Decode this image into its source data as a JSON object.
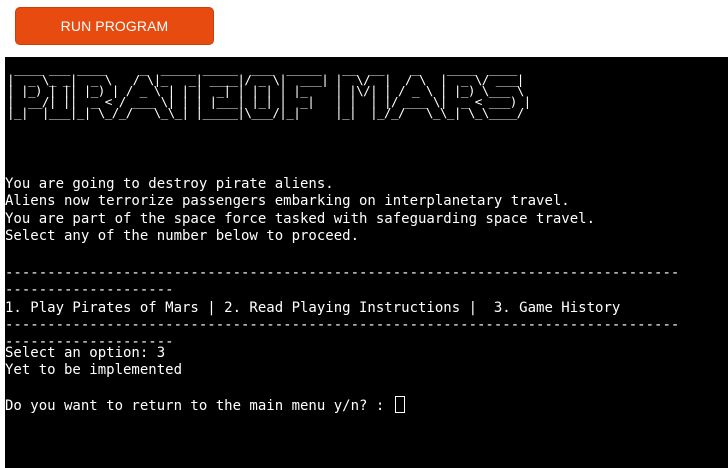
{
  "header": {
    "run_button_label": "RUN PROGRAM"
  },
  "terminal": {
    "banner": " ____ ___ ____     _  _____ _____  ___  _____   __  __    _    ____  ____\n|  _ \\_ _|  _ \\   / \\|_   _| ____|/ _ \\|  ___| |  \\/  |  / \\  |  _ \\/ ___|\n| |_) | || |_) | / _ \\ | | |  _| | | | | |_    | |\\/| | / _ \\ | |_) \\___ \\\n|  __/| ||  _ < / ___ \\| | | |___| |_| |  _|   | |  | |/ ___ \\|  _ < ___) |\n|_|  |___|_| \\_/_/   \\_\\_| |_____|\\___/|_|     |_|  |_/_/   \\_\\_| \\_\\____/",
    "intro_lines": [
      "You are going to destroy pirate aliens.",
      "Aliens now terrorize passengers embarking on interplanetary travel.",
      "You are part of the space force tasked with safeguarding space travel.",
      "Select any of the number below to proceed."
    ],
    "rule_line_1": "--------------------------------------------------------------------------------",
    "rule_line_2": "--------------------",
    "menu_line": "1. Play Pirates of Mars | 2. Read Playing Instructions |  3. Game History",
    "select_prompt": "Select an option: 3",
    "status_message": "Yet to be implemented",
    "return_prompt": "Do you want to return to the main menu y/n? : "
  }
}
